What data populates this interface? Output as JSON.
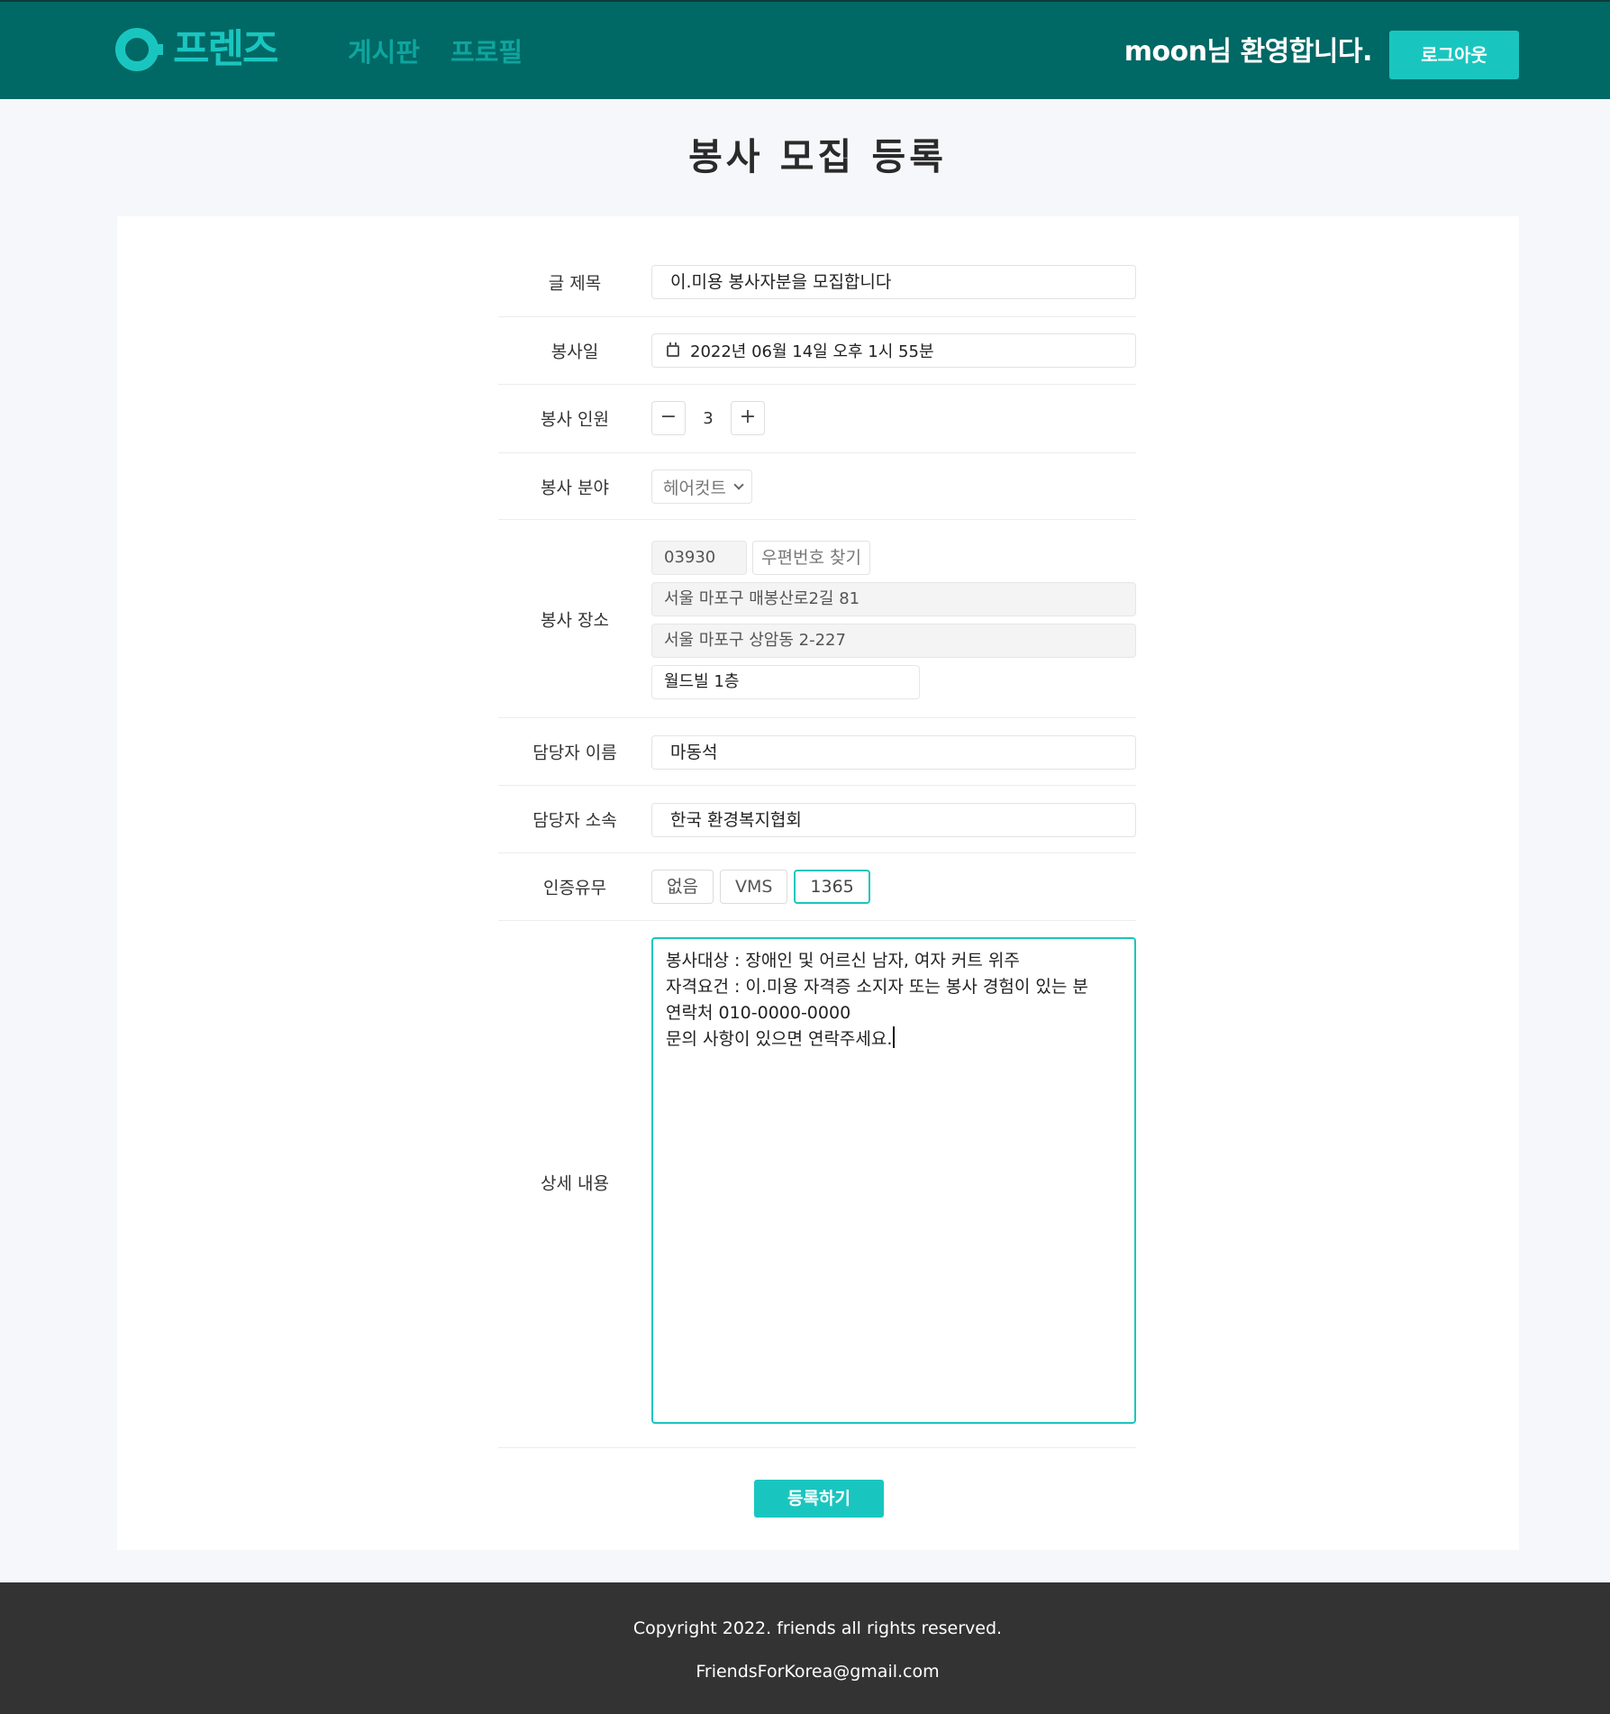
{
  "header": {
    "logo_text": "프렌즈",
    "nav": [
      "게시판",
      "프로필"
    ],
    "welcome": "moon님 환영합니다.",
    "logout_label": "로그아웃"
  },
  "page_title": "봉사 모집 등록",
  "form": {
    "title": {
      "label": "글 제목",
      "value": "이.미용 봉사자분을 모집합니다"
    },
    "date": {
      "label": "봉사일",
      "value": "2022년 06월 14일 오후 1시 55분"
    },
    "people": {
      "label": "봉사 인원",
      "value": "3",
      "minus": "−",
      "plus": "+"
    },
    "category": {
      "label": "봉사 분야",
      "value": "헤어컷트"
    },
    "location": {
      "label": "봉사 장소",
      "zip": "03930",
      "zip_button": "우편번호 찾기",
      "road_address": "서울 마포구 매봉산로2길 81",
      "jibun_address": "서울 마포구 상암동 2-227",
      "detail": "월드빌 1층"
    },
    "manager_name": {
      "label": "담당자 이름",
      "value": "마동석"
    },
    "manager_org": {
      "label": "담당자 소속",
      "value": "한국 환경복지협회"
    },
    "certification": {
      "label": "인증유무",
      "options": [
        "없음",
        "VMS",
        "1365"
      ],
      "selected": "1365"
    },
    "details": {
      "label": "상세 내용",
      "lines": [
        "봉사대상 : 장애인 및 어르신 남자, 여자 커트 위주",
        "자격요건 : 이.미용 자격증 소지자 또는 봉사 경험이 있는 분",
        "연락처 010-0000-0000",
        "문의 사항이 있으면 연락주세요."
      ]
    },
    "submit_label": "등록하기"
  },
  "footer": {
    "copyright": "Copyright 2022. friends all rights reserved.",
    "email": "FriendsForKorea@gmail.com"
  },
  "colors": {
    "header_bg": "#006865",
    "accent": "#19c6bf",
    "footer_bg": "#333333"
  }
}
